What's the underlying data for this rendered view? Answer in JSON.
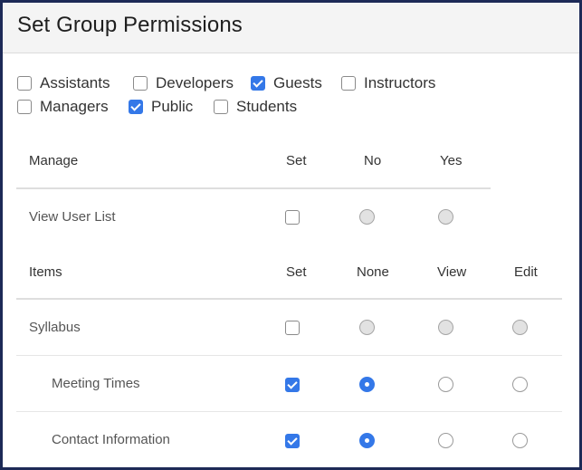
{
  "title": "Set Group Permissions",
  "groups": [
    {
      "label": "Assistants",
      "checked": false
    },
    {
      "label": "Developers",
      "checked": false
    },
    {
      "label": "Guests",
      "checked": true
    },
    {
      "label": "Instructors",
      "checked": false
    },
    {
      "label": "Managers",
      "checked": false
    },
    {
      "label": "Public",
      "checked": true
    },
    {
      "label": "Students",
      "checked": false
    }
  ],
  "manage": {
    "headers": {
      "name": "Manage",
      "set": "Set",
      "no": "No",
      "yes": "Yes"
    },
    "rows": [
      {
        "label": "View User List",
        "set": false,
        "selected": "none",
        "disabled": true
      }
    ]
  },
  "items": {
    "headers": {
      "name": "Items",
      "set": "Set",
      "none": "None",
      "view": "View",
      "edit": "Edit"
    },
    "rows": [
      {
        "label": "Syllabus",
        "set": false,
        "selected": "none",
        "disabled": true
      },
      {
        "label": "Meeting Times",
        "set": true,
        "selected": "none",
        "disabled": false
      },
      {
        "label": "Contact Information",
        "set": true,
        "selected": "none",
        "disabled": false
      }
    ]
  },
  "colors": {
    "accent": "#3478e8",
    "frame": "#1d2a57",
    "header_bg": "#f4f4f4"
  }
}
